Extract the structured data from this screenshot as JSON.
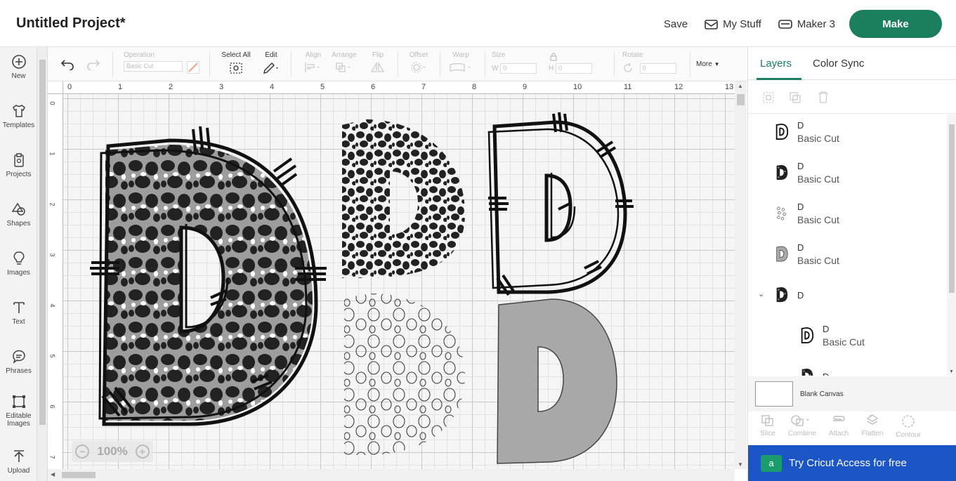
{
  "header": {
    "project_title": "Untitled Project*",
    "save_label": "Save",
    "mystuff_label": "My Stuff",
    "machine_label": "Maker 3",
    "make_label": "Make"
  },
  "sidebar": {
    "items": [
      {
        "label": "New",
        "icon": "plus-circle-icon"
      },
      {
        "label": "Templates",
        "icon": "shirt-icon"
      },
      {
        "label": "Projects",
        "icon": "clipboard-icon"
      },
      {
        "label": "Shapes",
        "icon": "shapes-icon"
      },
      {
        "label": "Images",
        "icon": "lightbulb-icon"
      },
      {
        "label": "Text",
        "icon": "text-icon"
      },
      {
        "label": "Phrases",
        "icon": "speech-icon"
      },
      {
        "label": "Editable Images",
        "icon": "crop-icon"
      },
      {
        "label": "Upload",
        "icon": "upload-icon"
      }
    ]
  },
  "toolbar": {
    "operation_label": "Operation",
    "operation_value": "Basic Cut",
    "select_all_label": "Select All",
    "edit_label": "Edit",
    "align_label": "Align",
    "arrange_label": "Arrange",
    "flip_label": "Flip",
    "offset_label": "Offset",
    "warp_label": "Warp",
    "size_label": "Size",
    "w_label": "W",
    "w_value": "0",
    "h_label": "H",
    "h_value": "0",
    "rotate_label": "Rotate",
    "rotate_value": "0",
    "more_label": "More"
  },
  "ruler": {
    "top": [
      "0",
      "1",
      "2",
      "3",
      "4",
      "5",
      "6",
      "7",
      "8",
      "9",
      "10",
      "11",
      "12",
      "13"
    ],
    "left": [
      "0",
      "1",
      "2",
      "3",
      "4",
      "5",
      "6",
      "7"
    ]
  },
  "canvas": {
    "zoom_value": "100%"
  },
  "panel": {
    "tab_layers": "Layers",
    "tab_color_sync": "Color Sync",
    "layers": [
      {
        "name": "D",
        "type": "Basic Cut",
        "thumb": "outline"
      },
      {
        "name": "D",
        "type": "Basic Cut",
        "thumb": "leopard"
      },
      {
        "name": "D",
        "type": "Basic Cut",
        "thumb": "spots"
      },
      {
        "name": "D",
        "type": "Basic Cut",
        "thumb": "gray"
      },
      {
        "name": "D",
        "type": "",
        "thumb": "group"
      },
      {
        "name": "D",
        "type": "Basic Cut",
        "thumb": "outline"
      },
      {
        "name": "D",
        "type": "",
        "thumb": "leopard"
      }
    ],
    "blank_canvas_label": "Blank Canvas",
    "ops": [
      "Slice",
      "Combine",
      "Attach",
      "Flatten",
      "Contour"
    ],
    "access_label": "Try Cricut Access for free",
    "access_badge": "a"
  },
  "colors": {
    "accent": "#1b7e5c",
    "access_blue": "#1c56c6",
    "gray_fill": "#a9a9a9"
  }
}
